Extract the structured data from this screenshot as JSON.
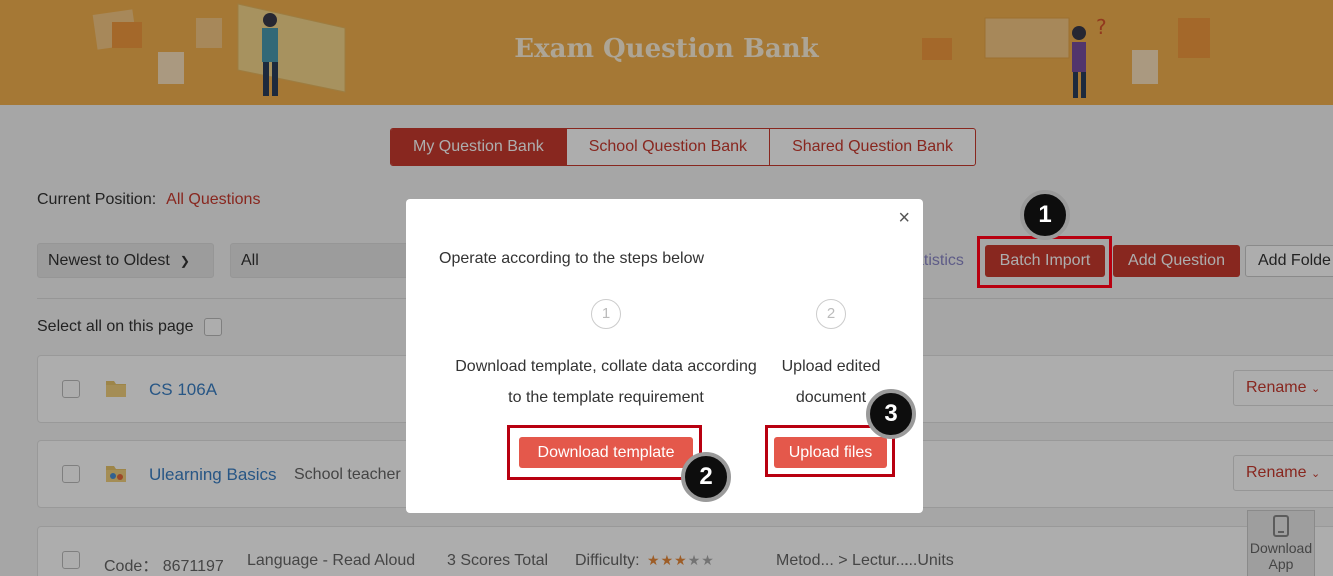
{
  "banner": {
    "title": "Exam Question Bank"
  },
  "tabs": [
    {
      "label": "My Question Bank"
    },
    {
      "label": "School Question Bank"
    },
    {
      "label": "Shared Question Bank"
    }
  ],
  "breadcrumb": {
    "label": "Current Position:",
    "value": "All Questions"
  },
  "toolbar": {
    "sort": "Newest to Oldest",
    "filter": "All",
    "statistics": "atistics",
    "batch_import": "Batch Import",
    "add_question": "Add Question",
    "add_folder": "Add Folde"
  },
  "select_all": "Select all on this page",
  "rows": [
    {
      "name": "CS 106A",
      "owner": "",
      "action": "Rename"
    },
    {
      "name": "Ulearning Basics",
      "owner": "School teacher",
      "action": "Rename"
    }
  ],
  "question_row": {
    "code": "Code： 8671197",
    "type": "Language - Read Aloud",
    "scores": "3 Scores Total",
    "difficulty_label": "Difficulty:",
    "difficulty": 3,
    "difficulty_max": 5,
    "path": "Metod... > Lectur...",
    "units": "...Units"
  },
  "download_app": {
    "line1": "Download",
    "line2": "App"
  },
  "modal": {
    "heading": "Operate according to the steps below",
    "steps": [
      {
        "num": "1",
        "line1": "Download template, collate data according",
        "line2": "to the template requirement",
        "button": "Download template"
      },
      {
        "num": "2",
        "line1": "Upload edited",
        "line2": "document",
        "button": "Upload files"
      }
    ],
    "close": "×"
  },
  "badges": [
    "1",
    "2",
    "3"
  ],
  "colors": {
    "brand_red": "#c93a2f",
    "banner": "#f3b24f",
    "highlight": "#b80010"
  }
}
